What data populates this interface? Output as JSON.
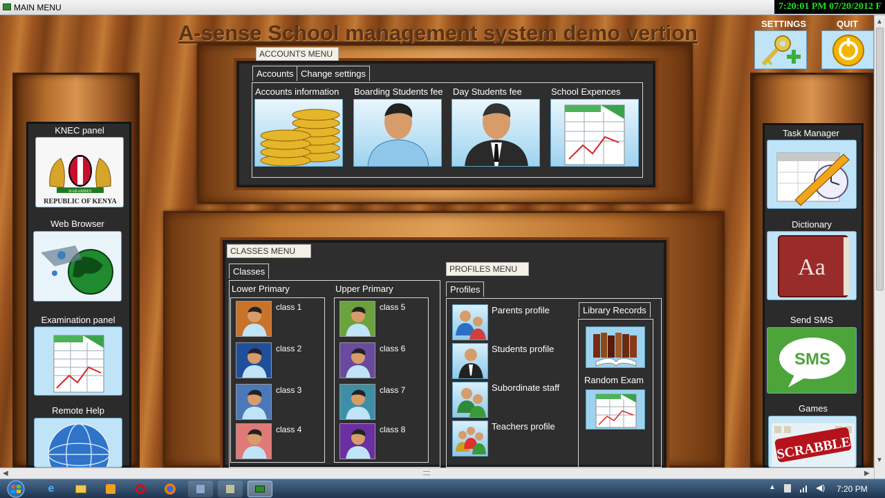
{
  "window": {
    "title": "MAIN MENU"
  },
  "clock": "7:20:01 PM 07/20/2012 F",
  "app_title": "A-sense School management system demo vertion",
  "top_buttons": {
    "settings": "SETTINGS",
    "quit": "QUIT"
  },
  "left_panel": {
    "items": [
      {
        "label": "KNEC panel",
        "icon": "kenya-coat-of-arms-icon",
        "caption": "REPUBLIC OF KENYA",
        "motto": "HARAMBEE"
      },
      {
        "label": "Web Browser",
        "icon": "globe-icon"
      },
      {
        "label": "Examination panel",
        "icon": "spreadsheet-chart-icon"
      },
      {
        "label": "Remote Help",
        "icon": "network-globe-icon"
      }
    ]
  },
  "right_panel": {
    "items": [
      {
        "label": "Task Manager",
        "icon": "calendar-pencil-icon"
      },
      {
        "label": "Dictionary",
        "icon": "dictionary-book-icon",
        "book_text": "Aa"
      },
      {
        "label": "Send SMS",
        "icon": "sms-bubble-icon",
        "bubble_text": "SMS"
      },
      {
        "label": "Games",
        "icon": "scrabble-icon",
        "game_text": "SCRABBLE"
      }
    ]
  },
  "accounts_menu": {
    "header": "ACCOUNTS MENU",
    "tabs": [
      "Accounts",
      "Change settings"
    ],
    "items": [
      {
        "label": "Accounts information",
        "icon": "coins-icon"
      },
      {
        "label": "Boarding Students fee",
        "icon": "person-icon"
      },
      {
        "label": "Day Students fee",
        "icon": "businessman-icon"
      },
      {
        "label": "School Expences",
        "icon": "spreadsheet-chart-icon"
      }
    ]
  },
  "classes_menu": {
    "header": "CLASSES MENU",
    "tab": "Classes",
    "lower": {
      "title": "Lower Primary",
      "classes": [
        "class 1",
        "class 2",
        "class 3",
        "class 4"
      ],
      "colors": [
        "#c9732a",
        "#1f4f9a",
        "#4a78b8",
        "#e07a78"
      ]
    },
    "upper": {
      "title": "Upper Primary",
      "classes": [
        "class 5",
        "class 6",
        "class 7",
        "class 8"
      ],
      "colors": [
        "#6aa23c",
        "#6a4a9c",
        "#3d8fa6",
        "#6a2fa0"
      ]
    }
  },
  "profiles_menu": {
    "header": "PROFILES MENU",
    "tab": "Profiles",
    "items": [
      "Parents profile",
      "Students profile",
      "Subordinate staff",
      "Teachers profile"
    ],
    "library_tab": "Library Records",
    "random_exam": "Random Exam"
  },
  "taskbar": {
    "time": "7:20 PM"
  }
}
